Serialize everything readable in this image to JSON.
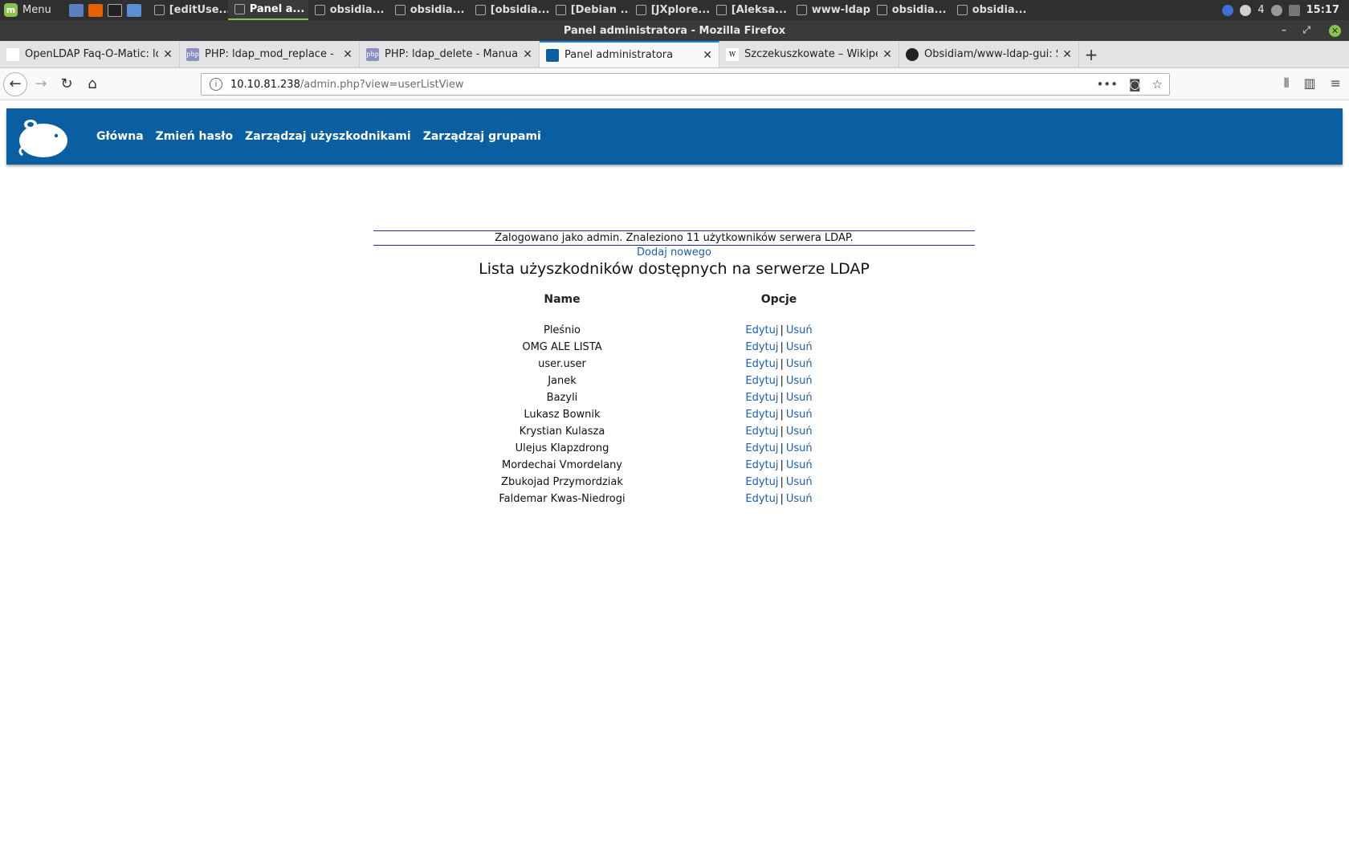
{
  "taskbar": {
    "menu_label": "Menu",
    "tasks": [
      {
        "label": "[editUse...",
        "active": false
      },
      {
        "label": "Panel a...",
        "active": true
      },
      {
        "label": "obsidia...",
        "active": false
      },
      {
        "label": "obsidia...",
        "active": false
      },
      {
        "label": "[obsidia...",
        "active": false
      },
      {
        "label": "[Debian ...",
        "active": false
      },
      {
        "label": "[JXplore...",
        "active": false
      },
      {
        "label": "[Aleksa...",
        "active": false
      },
      {
        "label": "www-ldap",
        "active": false
      },
      {
        "label": "obsidia...",
        "active": false
      },
      {
        "label": "obsidia...",
        "active": false
      }
    ],
    "tray_count": "4",
    "clock": "15:17"
  },
  "window": {
    "title": "Panel administratora - Mozilla Firefox"
  },
  "browser": {
    "tabs": [
      {
        "label": "OpenLDAP Faq-O-Matic: ldap_add",
        "icon": "openldap-icon",
        "active": false
      },
      {
        "label": "PHP: ldap_mod_replace - Manual",
        "icon": "php-icon",
        "active": false
      },
      {
        "label": "PHP: ldap_delete - Manual",
        "icon": "php-icon",
        "active": false
      },
      {
        "label": "Panel administratora",
        "icon": "site-icon",
        "active": true
      },
      {
        "label": "Szczekuszkowate – Wikipedia",
        "icon": "wikipedia-icon",
        "active": false
      },
      {
        "label": "Obsidiam/www-ldap-gui: Simple",
        "icon": "github-icon",
        "active": false
      }
    ],
    "url_host": "10.10.81.238",
    "url_path": "/admin.php?view=userListView"
  },
  "site": {
    "nav": [
      "Główna",
      "Zmień hasło",
      "Zarządzaj użyszkodnikami",
      "Zarządzaj grupami"
    ],
    "status_text": "Zalogowano jako admin. Znaleziono 11 użytkowników serwera LDAP.",
    "add_new_label": "Dodaj nowego",
    "list_title": "Lista użyszkodników dostępnych na serwerze LDAP",
    "table": {
      "headers": {
        "name": "Name",
        "options": "Opcje"
      },
      "edit_label": "Edytuj",
      "delete_label": "Usuń",
      "separator": "|",
      "users": [
        "Pleśnio",
        "OMG ALE LISTA",
        "user.user",
        "Janek",
        "Bazyli",
        "Lukasz Bownik",
        "Krystian Kulasza",
        "Ulejus Klapzdrong",
        "Mordechai Vmordelany",
        "Zbukojad Przymordziak",
        "Faldemar Kwas-Niedrogi"
      ]
    }
  },
  "colors": {
    "header_blue": "#0a5fa3",
    "link_blue": "#1a5fb4",
    "mint_green": "#8bc34a"
  }
}
